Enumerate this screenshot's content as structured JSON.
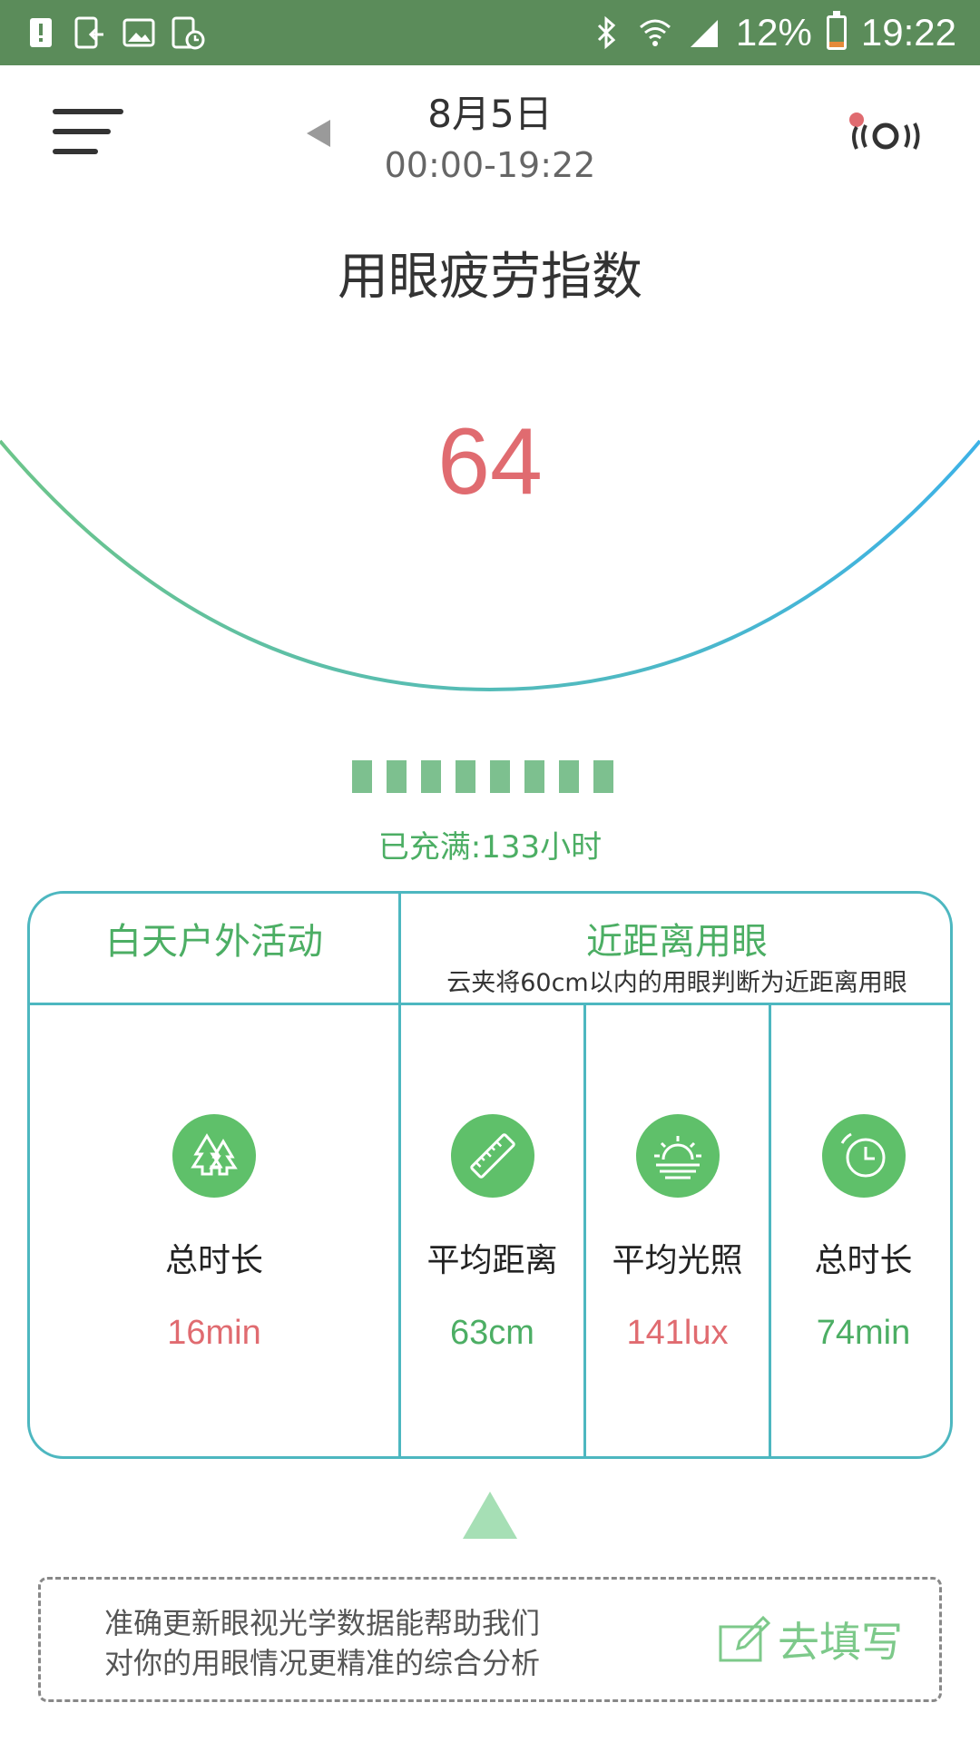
{
  "status_bar": {
    "battery_percent": "12%",
    "time": "19:22",
    "icons": [
      "alert-icon",
      "download-icon",
      "image-icon",
      "timer-icon",
      "bluetooth-icon",
      "wifi-icon",
      "signal-icon",
      "battery-icon"
    ]
  },
  "header": {
    "date": "8月5日",
    "time_range": "00:00-19:22"
  },
  "title": "用眼疲劳指数",
  "gauge": {
    "score": "64",
    "colors": {
      "start": "#6cc58a",
      "end": "#3db2e6"
    }
  },
  "charge": {
    "segments": 8,
    "label": "已充满:133小时",
    "color": "#7dc08f"
  },
  "table": {
    "outdoor_header": "白天户外活动",
    "near_header": "近距离用眼",
    "near_sub": "云夹将60cm以内的用眼判断为近距离用眼",
    "columns": [
      {
        "icon": "trees-icon",
        "label": "总时长",
        "value": "16min",
        "tone": "red"
      },
      {
        "icon": "ruler-icon",
        "label": "平均距离",
        "value": "63cm",
        "tone": "green"
      },
      {
        "icon": "sunrise-icon",
        "label": "平均光照",
        "value": "141lux",
        "tone": "red"
      },
      {
        "icon": "clock-icon",
        "label": "总时长",
        "value": "74min",
        "tone": "green"
      }
    ]
  },
  "notice": {
    "line1": "准确更新眼视光学数据能帮助我们",
    "line2": "对你的用眼情况更精准的综合分析",
    "button": "去填写"
  }
}
